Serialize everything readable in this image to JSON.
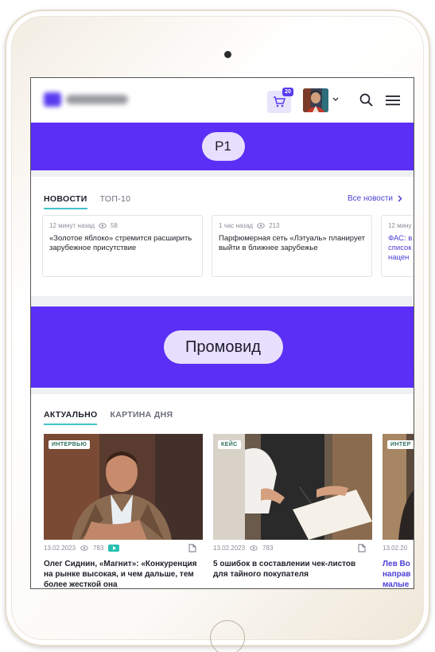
{
  "header": {
    "cart_count": "20"
  },
  "ads": {
    "top_label": "P1",
    "promo_label": "Промовид"
  },
  "news": {
    "tabs": [
      "НОВОСТИ",
      "ТОП-10"
    ],
    "all_news_label": "Все новости",
    "items": [
      {
        "time": "12 минут назад",
        "views": "58",
        "title": "«Золотое яблоко» стремится расширить зарубежное присутствие"
      },
      {
        "time": "1 час назад",
        "views": "213",
        "title": "Парфюмерная сеть «Лэтуаль» планирует выйти в ближнее зарубежье"
      },
      {
        "time": "12 мину",
        "views": "",
        "title": "ФАС: в список нацен"
      }
    ]
  },
  "feed": {
    "tabs": [
      "АКТУАЛЬНО",
      "КАРТИНА ДНЯ"
    ],
    "items": [
      {
        "tag": "ИНТЕРВЬЮ",
        "date": "13.02.2023",
        "views": "783",
        "title": "Олег Сиднин, «Магнит»: «Конкуренция на рынке высокая, и чем дальше, тем более жесткой она"
      },
      {
        "tag": "КЕЙС",
        "date": "13.02.2023",
        "views": "783",
        "title": "5 ошибок в составлении чек-листов для тайного покупателя"
      },
      {
        "tag": "ИНТЕР",
        "date": "13.02.20",
        "views": "",
        "title": "Лев Во направ малые"
      }
    ]
  },
  "colors": {
    "brand_violet": "#5b2ff5",
    "pill": "#e8defe",
    "accent_teal": "#41c3c8",
    "link": "#4b3fd6"
  }
}
